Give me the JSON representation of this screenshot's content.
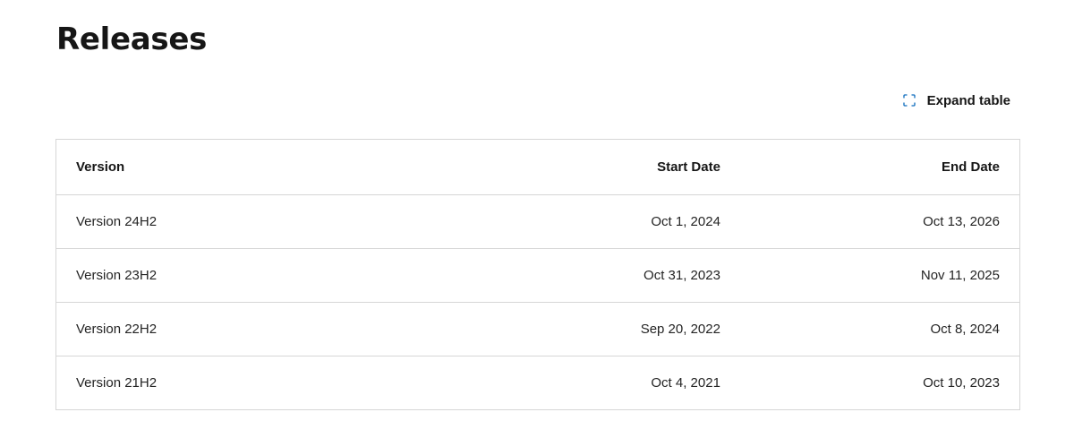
{
  "page": {
    "title": "Releases"
  },
  "toolbar": {
    "expand_label": "Expand table",
    "expand_icon": "expand-icon",
    "accent_color": "#0f6cbd"
  },
  "table": {
    "headers": {
      "version": "Version",
      "start_date": "Start Date",
      "end_date": "End Date"
    },
    "rows": [
      {
        "version": "Version 24H2",
        "start_date": "Oct 1, 2024",
        "end_date": "Oct 13, 2026"
      },
      {
        "version": "Version 23H2",
        "start_date": "Oct 31, 2023",
        "end_date": "Nov 11, 2025"
      },
      {
        "version": "Version 22H2",
        "start_date": "Sep 20, 2022",
        "end_date": "Oct 8, 2024"
      },
      {
        "version": "Version 21H2",
        "start_date": "Oct 4, 2021",
        "end_date": "Oct 10, 2023"
      }
    ]
  }
}
